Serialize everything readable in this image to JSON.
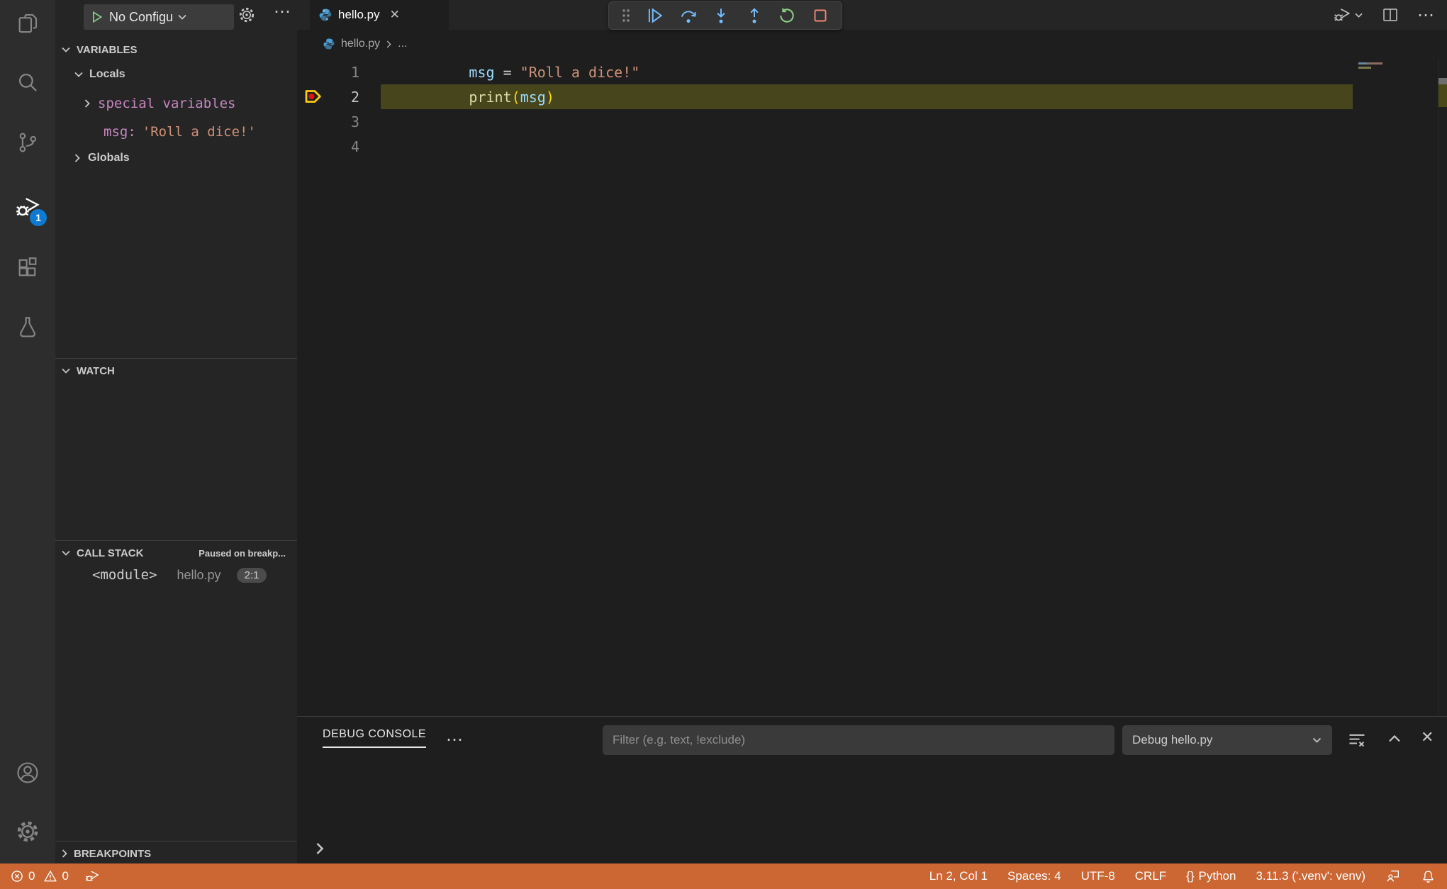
{
  "activity_bar": {
    "items": [
      {
        "label": "Explorer",
        "icon": "files-icon"
      },
      {
        "label": "Search",
        "icon": "search-icon"
      },
      {
        "label": "Source Control",
        "icon": "source-control-icon"
      },
      {
        "label": "Run and Debug",
        "icon": "debug-icon",
        "badge": "1",
        "active": true
      },
      {
        "label": "Extensions",
        "icon": "extensions-icon"
      },
      {
        "label": "Testing",
        "icon": "testing-icon"
      },
      {
        "label": "Accounts",
        "icon": "account-icon"
      },
      {
        "label": "Settings",
        "icon": "gear-icon"
      }
    ],
    "debug_badge": "1"
  },
  "sidebar": {
    "run_config_label": "No Configu",
    "variables": {
      "title": "VARIABLES",
      "locals_label": "Locals",
      "special_label": "special variables",
      "msg_key": "msg:",
      "msg_value": "'Roll a dice!'",
      "globals_label": "Globals"
    },
    "watch": {
      "title": "WATCH"
    },
    "call_stack": {
      "title": "CALL STACK",
      "status": "Paused on breakp...",
      "frame_name": "<module>",
      "frame_file": "hello.py",
      "frame_pos": "2:1"
    },
    "breakpoints": {
      "title": "BREAKPOINTS"
    }
  },
  "editor": {
    "tab_label": "hello.py",
    "breadcrumb_file": "hello.py",
    "breadcrumb_more": "...",
    "line_numbers": [
      "1",
      "2",
      "3",
      "4"
    ],
    "code": {
      "l1": {
        "a": "msg",
        "b": " = ",
        "c": "\"Roll a dice!\""
      },
      "l2": {
        "a": "print",
        "b": "(",
        "c": "msg",
        "d": ")"
      }
    },
    "toolbar_icons": [
      "grip",
      "continue",
      "step-over",
      "step-into",
      "step-out",
      "restart",
      "stop"
    ]
  },
  "panel": {
    "tab": "DEBUG CONSOLE",
    "filter_placeholder": "Filter (e.g. text, !exclude)",
    "session_dropdown": "Debug hello.py"
  },
  "status_bar": {
    "errors": "0",
    "warnings": "0",
    "line_col": "Ln 2, Col 1",
    "indent": "Spaces: 4",
    "encoding": "UTF-8",
    "eol": "CRLF",
    "braces": "{}",
    "language": "Python",
    "interpreter": "3.11.3 ('.venv': venv)"
  },
  "colors": {
    "status_bar": "#cc6633",
    "badge_blue": "#0e7ad3",
    "debug_blue": "#75beff",
    "debug_green": "#89d185",
    "debug_red": "#f48771",
    "current_line": "#47451c"
  }
}
